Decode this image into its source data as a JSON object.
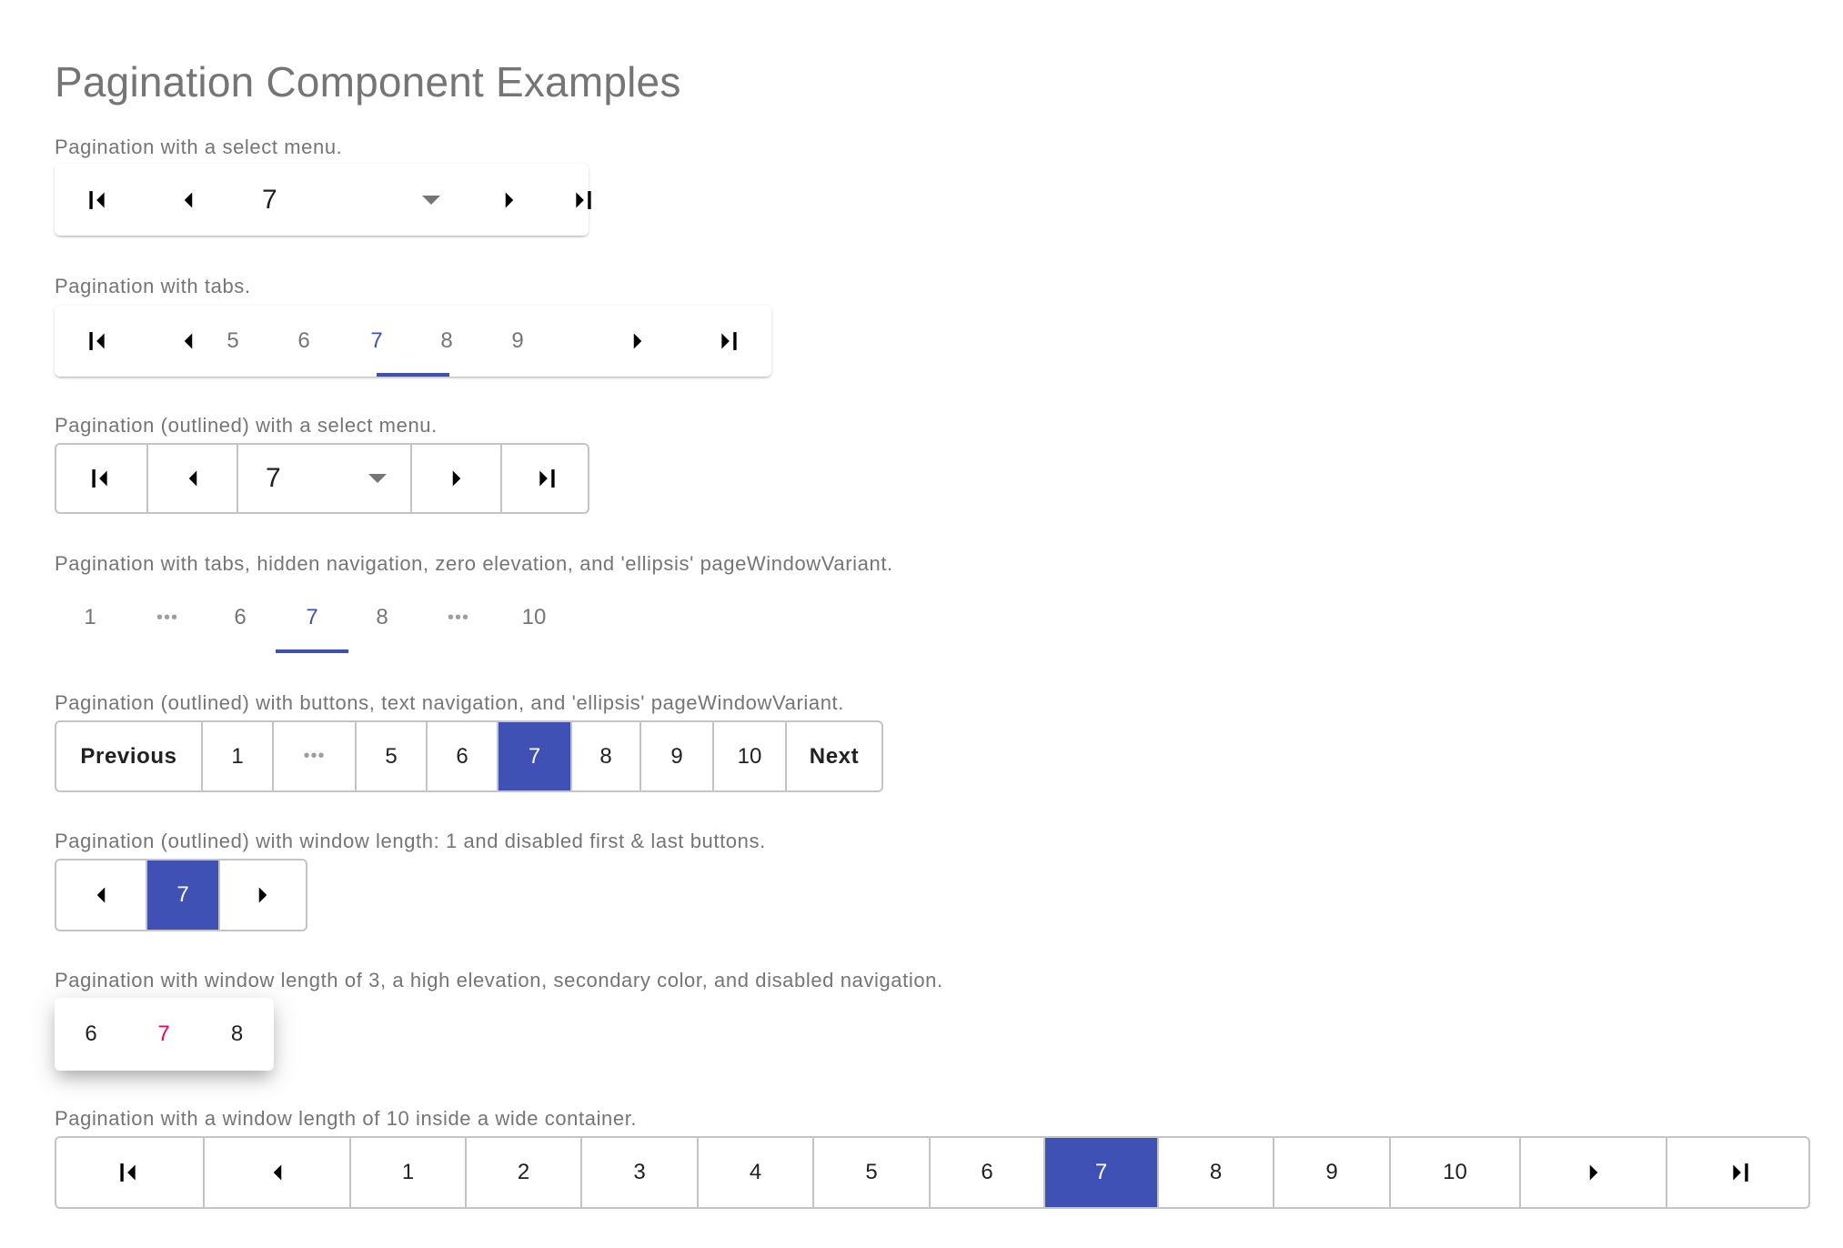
{
  "page": {
    "title": "Pagination Component Examples"
  },
  "colors": {
    "primary": "#3f51b5",
    "secondary": "#f50057",
    "border": "#c4c4c4",
    "label_text": "#757575"
  },
  "icons": {
    "first": "first-page-icon",
    "prev": "chevron-left-icon",
    "next": "chevron-right-icon",
    "last": "last-page-icon",
    "dropdown": "arrow-drop-down-icon",
    "ellipsis": "more-horiz-icon"
  },
  "examples": [
    {
      "label": "Pagination with a select menu.",
      "selected_value": "7"
    },
    {
      "label": "Pagination with tabs.",
      "pages": [
        "5",
        "6",
        "7",
        "8",
        "9"
      ],
      "selected": "7"
    },
    {
      "label": "Pagination (outlined) with a select menu.",
      "selected_value": "7"
    },
    {
      "label": "Pagination with tabs, hidden navigation, zero elevation, and 'ellipsis' pageWindowVariant.",
      "items": [
        "1",
        "•••",
        "6",
        "7",
        "8",
        "•••",
        "10"
      ],
      "selected": "7"
    },
    {
      "label": "Pagination (outlined) with buttons, text navigation, and 'ellipsis' pageWindowVariant.",
      "prev_label": "Previous",
      "next_label": "Next",
      "items": [
        "1",
        "•••",
        "5",
        "6",
        "7",
        "8",
        "9",
        "10"
      ],
      "selected": "7"
    },
    {
      "label": "Pagination (outlined) with window length: 1 and disabled first & last buttons.",
      "pages": [
        "7"
      ],
      "selected": "7"
    },
    {
      "label": "Pagination with window length of 3, a high elevation, secondary color, and disabled navigation.",
      "pages": [
        "6",
        "7",
        "8"
      ],
      "selected": "7"
    },
    {
      "label": "Pagination with a window length of 10 inside a wide container.",
      "pages": [
        "1",
        "2",
        "3",
        "4",
        "5",
        "6",
        "7",
        "8",
        "9",
        "10"
      ],
      "selected": "7"
    }
  ]
}
